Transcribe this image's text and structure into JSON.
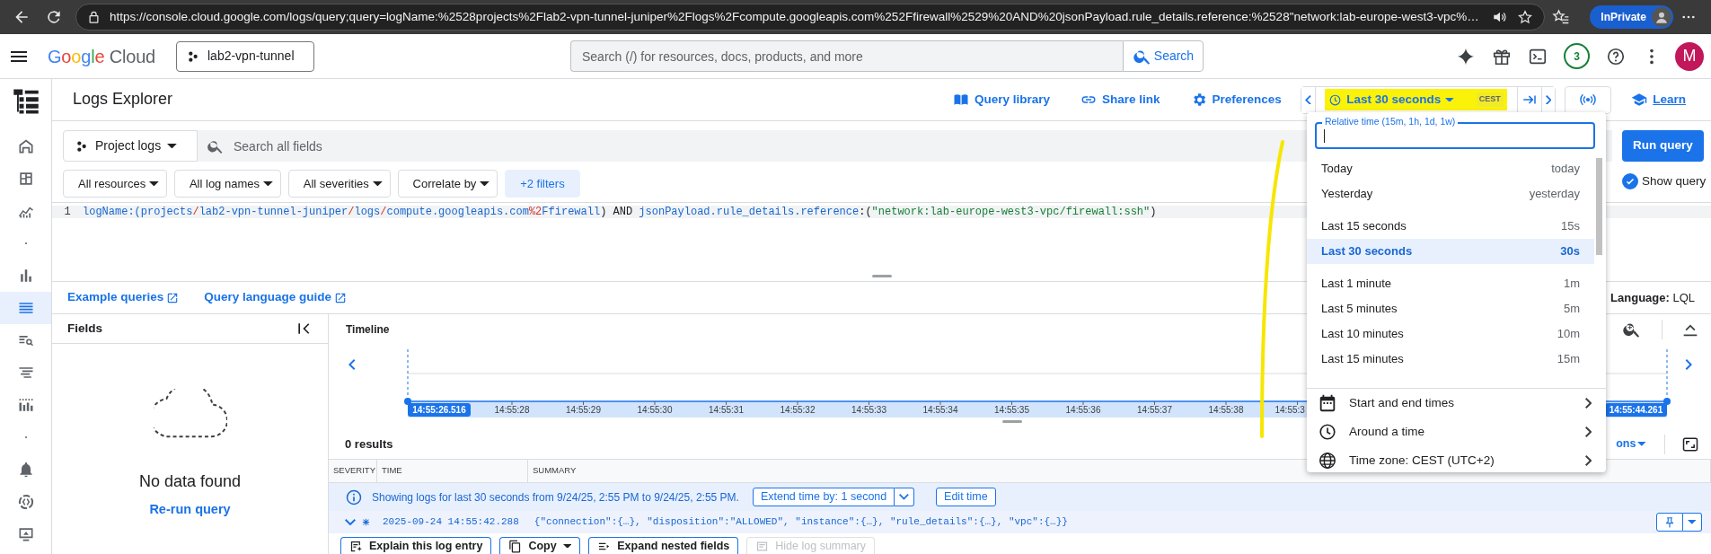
{
  "browser": {
    "url": "https://console.cloud.google.com/logs/query;query=logName:%2528projects%2Flab2-vpn-tunnel-juniper%2Flogs%2Fcompute.googleapis.com%252Ffirewall%2529%20AND%20jsonPayload.rule_details.reference:%2528\"network:lab-europe-west3-vpc%…",
    "profile_label": "InPrivate"
  },
  "header": {
    "logo": {
      "brand": "Google",
      "product": "Cloud"
    },
    "project": "lab2-vpn-tunnel",
    "search_placeholder": "Search (/) for resources, docs, products, and more",
    "search_button": "Search",
    "notification_count": "3",
    "avatar_initial": "M"
  },
  "nav_rail": [
    {
      "selected": false
    },
    {
      "selected": false
    },
    {
      "selected": false
    },
    {
      "selected": false
    },
    {
      "selected": false
    },
    {
      "selected": true
    },
    {
      "selected": false
    },
    {
      "selected": false
    },
    {
      "selected": false
    },
    {
      "selected": false
    },
    {
      "selected": false
    },
    {
      "selected": false
    },
    {
      "selected": false
    }
  ],
  "page": {
    "title": "Logs Explorer",
    "actions": [
      "Query library",
      "Share link",
      "Preferences"
    ],
    "time_range": {
      "label": "Last 30 seconds",
      "zone": "CEST",
      "highlighted": true
    },
    "learn": "Learn"
  },
  "query": {
    "scope": "Project logs",
    "search_placeholder": "Search all fields",
    "filters": [
      {
        "label": "All resources",
        "kind": "dropdown"
      },
      {
        "label": "All log names",
        "kind": "dropdown"
      },
      {
        "label": "All severities",
        "kind": "dropdown"
      },
      {
        "label": "Correlate by",
        "kind": "dropdown"
      },
      {
        "label": "+2 filters",
        "kind": "applied"
      }
    ],
    "run_button": "Run query",
    "show_query": {
      "label": "Show query",
      "checked": true
    },
    "line_number": "1",
    "tokens": [
      {
        "text": "logName:(",
        "kind": "field"
      },
      {
        "text": "projects",
        "kind": "field"
      },
      {
        "text": "/",
        "kind": "sep"
      },
      {
        "text": "lab2-vpn-tunnel-juniper",
        "kind": "field"
      },
      {
        "text": "/",
        "kind": "sep"
      },
      {
        "text": "logs",
        "kind": "field"
      },
      {
        "text": "/",
        "kind": "sep"
      },
      {
        "text": "compute.googleapis.com",
        "kind": "field"
      },
      {
        "text": "%2",
        "kind": "sep"
      },
      {
        "text": "Ffirewall",
        "kind": "field"
      },
      {
        "text": ") AND ",
        "kind": "op"
      },
      {
        "text": "jsonPayload.rule_details.reference",
        "kind": "field"
      },
      {
        "text": ":(",
        "kind": "op"
      },
      {
        "text": "\"network:lab-europe-west3-vpc/firewall:ssh\"",
        "kind": "string"
      },
      {
        "text": ")",
        "kind": "op"
      }
    ],
    "links": [
      "Example queries",
      "Query language guide"
    ],
    "language": "**Language:** LQL"
  },
  "fields_panel": {
    "title": "Fields",
    "empty_title": "No data found",
    "rerun_link": "Re-run query"
  },
  "timeline": {
    "title": "Timeline",
    "start_label": "14:55:26.516",
    "end_label": "14:55:44.261",
    "ticks": [
      "14:55:28",
      "14:55:29",
      "14:55:30",
      "14:55:31",
      "14:55:32",
      "14:55:33",
      "14:55:34",
      "14:55:35",
      "14:55:36",
      "14:55:37",
      "14:55:38",
      "14:55:3"
    ]
  },
  "results": {
    "count": "0 results",
    "options_partial": "ons",
    "columns": [
      "SEVERITY",
      "TIME",
      "SUMMARY"
    ],
    "info": "Showing logs for last 30 seconds from 9/24/25, 2:55 PM to 9/24/25, 2:55 PM.",
    "extend_button": "Extend time by: 1 second",
    "edit_button": "Edit time",
    "entries": [
      {
        "timestamp": "2025-09-24 14:55:42.288",
        "summary": "{\"connection\":{…}, \"disposition\":\"ALLOWED\", \"instance\":{…}, \"rule_details\":{…}, \"vpc\":{…}}",
        "expanded": true
      }
    ],
    "entry_actions": [
      {
        "label": "Explain this log entry",
        "disabled": false
      },
      {
        "label": "Copy",
        "disabled": false
      },
      {
        "label": "Expand nested fields",
        "disabled": false
      },
      {
        "label": "Hide log summary",
        "disabled": true
      }
    ]
  },
  "time_menu": {
    "field_label": "Relative time (15m, 1h, 1d, 1w)",
    "groups": [
      [
        {
          "label": "Today",
          "short": "today",
          "selected": false
        },
        {
          "label": "Yesterday",
          "short": "yesterday",
          "selected": false
        }
      ],
      [
        {
          "label": "Last 15 seconds",
          "short": "15s",
          "selected": false
        },
        {
          "label": "Last 30 seconds",
          "short": "30s",
          "selected": true
        }
      ],
      [
        {
          "label": "Last 1 minute",
          "short": "1m",
          "selected": false
        },
        {
          "label": "Last 5 minutes",
          "short": "5m",
          "selected": false
        },
        {
          "label": "Last 10 minutes",
          "short": "10m",
          "selected": false
        },
        {
          "label": "Last 15 minutes",
          "short": "15m",
          "selected": false
        }
      ]
    ],
    "actions": [
      "Start and end times",
      "Around a time",
      "Time zone: CEST (UTC+2)"
    ]
  }
}
